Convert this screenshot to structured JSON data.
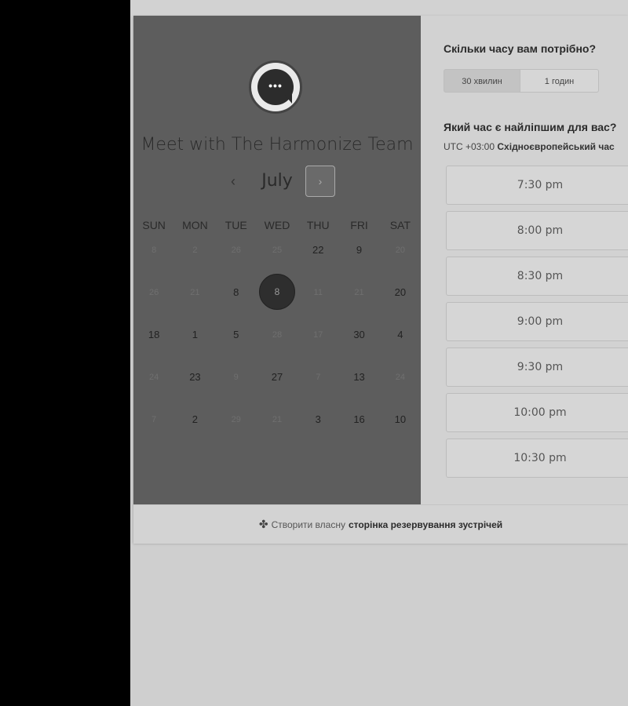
{
  "meeting": {
    "title": "Meet with The Harmonize Team",
    "avatar_icon": "chat-bubble-icon"
  },
  "calendar": {
    "month": "July",
    "prev_icon": "‹",
    "next_icon": "›",
    "weekdays": [
      "SUN",
      "MON",
      "TUE",
      "WED",
      "THU",
      "FRI",
      "SAT"
    ],
    "weeks": [
      [
        {
          "d": "8",
          "dim": true
        },
        {
          "d": "2",
          "dim": true
        },
        {
          "d": "26",
          "dim": true
        },
        {
          "d": "25",
          "dim": true
        },
        {
          "d": "22",
          "dim": false
        },
        {
          "d": "9",
          "dim": false
        },
        {
          "d": "20",
          "dim": true
        }
      ],
      [
        {
          "d": "26",
          "dim": true
        },
        {
          "d": "21",
          "dim": true
        },
        {
          "d": "8",
          "dim": false
        },
        {
          "d": "8",
          "dim": false,
          "selected": true
        },
        {
          "d": "11",
          "dim": true
        },
        {
          "d": "21",
          "dim": true
        },
        {
          "d": "20",
          "dim": false
        }
      ],
      [
        {
          "d": "18",
          "dim": false
        },
        {
          "d": "1",
          "dim": false
        },
        {
          "d": "5",
          "dim": false
        },
        {
          "d": "28",
          "dim": true
        },
        {
          "d": "17",
          "dim": true
        },
        {
          "d": "30",
          "dim": false
        },
        {
          "d": "4",
          "dim": false
        }
      ],
      [
        {
          "d": "24",
          "dim": true
        },
        {
          "d": "23",
          "dim": false
        },
        {
          "d": "9",
          "dim": true
        },
        {
          "d": "27",
          "dim": false
        },
        {
          "d": "7",
          "dim": true
        },
        {
          "d": "13",
          "dim": false
        },
        {
          "d": "24",
          "dim": true
        }
      ],
      [
        {
          "d": "7",
          "dim": true
        },
        {
          "d": "2",
          "dim": false
        },
        {
          "d": "29",
          "dim": true
        },
        {
          "d": "21",
          "dim": true
        },
        {
          "d": "3",
          "dim": false
        },
        {
          "d": "16",
          "dim": false
        },
        {
          "d": "10",
          "dim": false
        }
      ]
    ]
  },
  "duration": {
    "question": "Скільки часу вам потрібно?",
    "options": [
      "30 хвилин",
      "1 годин"
    ]
  },
  "time": {
    "question": "Який час є найліпшим для вас?",
    "tz_offset": "UTC +03:00",
    "tz_name": "Східноєвропейський час",
    "slots": [
      "7:30 pm",
      "8:00 pm",
      "8:30 pm",
      "9:00 pm",
      "9:30 pm",
      "10:00 pm",
      "10:30 pm"
    ]
  },
  "footer": {
    "prefix": "Створити власну",
    "link": "сторінка резервування зустрічей"
  }
}
